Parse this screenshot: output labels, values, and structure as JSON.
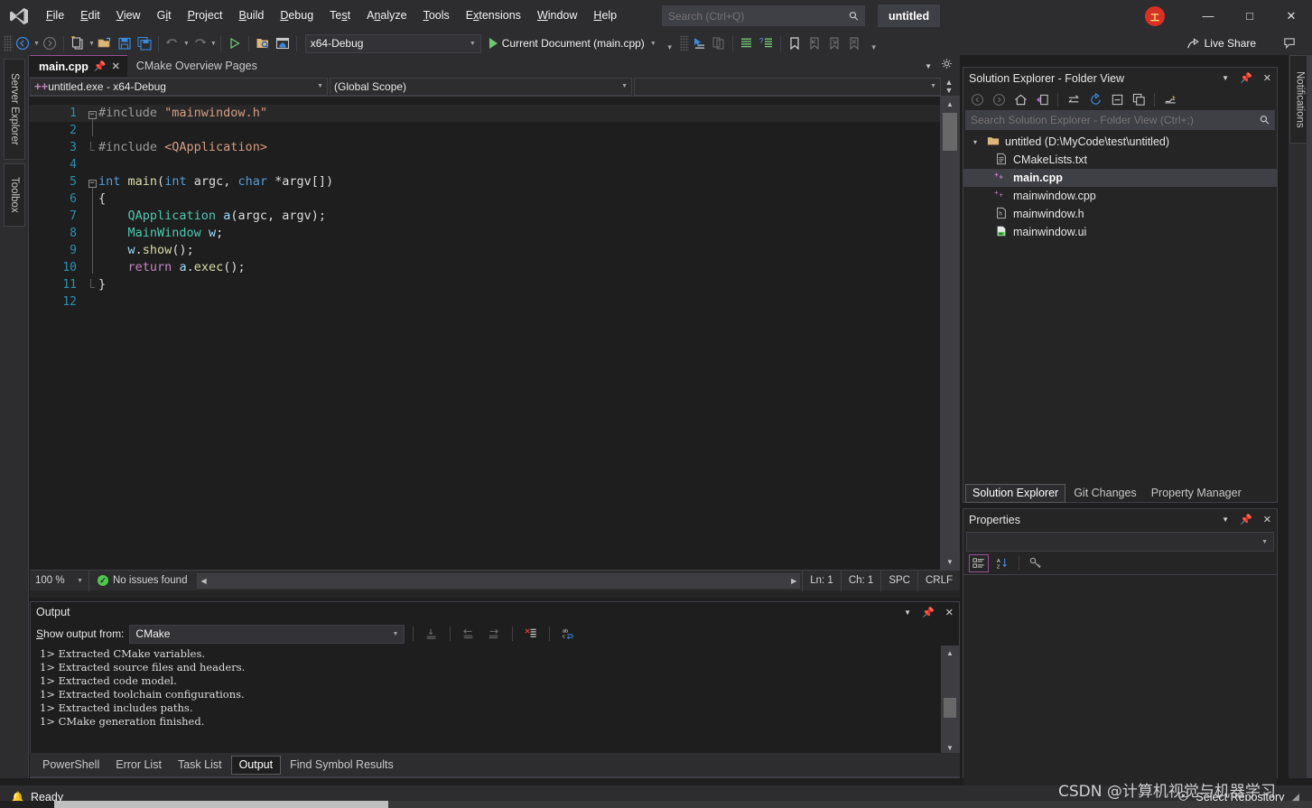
{
  "titlebar": {
    "logo": "visual-studio-logo",
    "menus": [
      "File",
      "Edit",
      "View",
      "Git",
      "Project",
      "Build",
      "Debug",
      "Test",
      "Analyze",
      "Tools",
      "Extensions",
      "Window",
      "Help"
    ],
    "search_placeholder": "Search (Ctrl+Q)",
    "window_title": "untitled",
    "user_badge": "工",
    "minimize": "minimize-icon",
    "maximize": "maximize-icon",
    "close": "close-icon"
  },
  "toolbar": {
    "back": "back-arrow-icon",
    "forward": "forward-arrow-icon",
    "new_item": "new-item-icon",
    "open_file": "open-file-icon",
    "save": "save-icon",
    "save_all": "save-all-icon",
    "undo": "undo-icon",
    "redo": "redo-icon",
    "run": "run-icon",
    "open_folder": "search-folder-icon",
    "home_window": "home-window-icon",
    "configuration": "x64-Debug",
    "startup_item": "Current Document (main.cpp)",
    "live_share": "Live Share",
    "feedback": "feedback-icon"
  },
  "left_rail": {
    "tabs": [
      "Server Explorer",
      "Toolbox"
    ]
  },
  "right_rail": {
    "tabs": [
      "Notifications"
    ]
  },
  "editor": {
    "tabs": [
      {
        "label": "main.cpp",
        "active": true,
        "pinned": true,
        "closable": true
      },
      {
        "label": "CMake Overview Pages",
        "active": false,
        "pinned": false,
        "closable": false
      }
    ],
    "navbar": {
      "project": "untitled.exe - x64-Debug",
      "scope": "(Global Scope)",
      "member": ""
    },
    "code": {
      "lines": [
        {
          "n": 1,
          "fold": "minus",
          "guide": false,
          "current": true,
          "tokens": [
            {
              "t": "#include ",
              "c": "pre"
            },
            {
              "t": "\"mainwindow.h\"",
              "c": "str"
            }
          ]
        },
        {
          "n": 2,
          "fold": "",
          "guide": true,
          "current": false,
          "tokens": []
        },
        {
          "n": 3,
          "fold": "end",
          "guide": true,
          "current": false,
          "tokens": [
            {
              "t": "#include ",
              "c": "pre"
            },
            {
              "t": "<QApplication>",
              "c": "str"
            }
          ]
        },
        {
          "n": 4,
          "fold": "",
          "guide": false,
          "current": false,
          "tokens": []
        },
        {
          "n": 5,
          "fold": "minus",
          "guide": false,
          "current": false,
          "tokens": [
            {
              "t": "int",
              "c": "kw"
            },
            {
              "t": " ",
              "c": "plain"
            },
            {
              "t": "main",
              "c": "fn"
            },
            {
              "t": "(",
              "c": "punc"
            },
            {
              "t": "int",
              "c": "kw"
            },
            {
              "t": " ",
              "c": "plain"
            },
            {
              "t": "argc",
              "c": "plain"
            },
            {
              "t": ", ",
              "c": "punc"
            },
            {
              "t": "char",
              "c": "kw"
            },
            {
              "t": " *",
              "c": "punc"
            },
            {
              "t": "argv",
              "c": "plain"
            },
            {
              "t": "[])",
              "c": "punc"
            }
          ]
        },
        {
          "n": 6,
          "fold": "bar",
          "guide": false,
          "current": false,
          "tokens": [
            {
              "t": "{",
              "c": "punc"
            }
          ]
        },
        {
          "n": 7,
          "fold": "bar",
          "guide": false,
          "current": false,
          "tokens": [
            {
              "t": "    ",
              "c": "plain"
            },
            {
              "t": "QApplication",
              "c": "type"
            },
            {
              "t": " ",
              "c": "plain"
            },
            {
              "t": "a",
              "c": "var"
            },
            {
              "t": "(argc, argv);",
              "c": "punc"
            }
          ]
        },
        {
          "n": 8,
          "fold": "bar",
          "guide": false,
          "current": false,
          "tokens": [
            {
              "t": "    ",
              "c": "plain"
            },
            {
              "t": "MainWindow",
              "c": "type"
            },
            {
              "t": " ",
              "c": "plain"
            },
            {
              "t": "w",
              "c": "var"
            },
            {
              "t": ";",
              "c": "punc"
            }
          ]
        },
        {
          "n": 9,
          "fold": "bar",
          "guide": false,
          "current": false,
          "tokens": [
            {
              "t": "    ",
              "c": "plain"
            },
            {
              "t": "w",
              "c": "var"
            },
            {
              "t": ".",
              "c": "punc"
            },
            {
              "t": "show",
              "c": "fn"
            },
            {
              "t": "();",
              "c": "punc"
            }
          ]
        },
        {
          "n": 10,
          "fold": "bar",
          "guide": false,
          "current": false,
          "tokens": [
            {
              "t": "    ",
              "c": "plain"
            },
            {
              "t": "return",
              "c": "kwp"
            },
            {
              "t": " ",
              "c": "plain"
            },
            {
              "t": "a",
              "c": "var"
            },
            {
              "t": ".",
              "c": "punc"
            },
            {
              "t": "exec",
              "c": "fn"
            },
            {
              "t": "();",
              "c": "punc"
            }
          ]
        },
        {
          "n": 11,
          "fold": "end",
          "guide": false,
          "current": false,
          "tokens": [
            {
              "t": "}",
              "c": "punc"
            }
          ]
        },
        {
          "n": 12,
          "fold": "",
          "guide": false,
          "current": false,
          "tokens": []
        }
      ]
    },
    "status": {
      "zoom": "100 %",
      "issues": "No issues found",
      "line": "Ln: 1",
      "char": "Ch: 1",
      "spaces": "SPC",
      "eol": "CRLF"
    }
  },
  "output": {
    "title": "Output",
    "filter_label": "Show output from:",
    "filter_value": "CMake",
    "toolbar_icons": [
      "clear-all-icon",
      "go-to-previous-icon",
      "go-to-next-icon",
      "clear-output-icon",
      "toggle-word-wrap-icon"
    ],
    "lines": [
      "1> Extracted CMake variables.",
      "1> Extracted source files and headers.",
      "1> Extracted code model.",
      "1> Extracted toolchain configurations.",
      "1> Extracted includes paths.",
      "1> CMake generation finished."
    ]
  },
  "bottom_tabs": [
    {
      "label": "PowerShell",
      "active": false
    },
    {
      "label": "Error List",
      "active": false
    },
    {
      "label": "Task List",
      "active": false
    },
    {
      "label": "Output",
      "active": true
    },
    {
      "label": "Find Symbol Results",
      "active": false
    }
  ],
  "solution_explorer": {
    "title": "Solution Explorer - Folder View",
    "toolbar_icons": [
      "back-icon",
      "forward-icon",
      "home-icon",
      "switch-views-icon",
      "sync-icon",
      "refresh-icon",
      "collapse-all-icon",
      "new-folder-icon",
      "show-all-files-icon"
    ],
    "search_placeholder": "Search Solution Explorer - Folder View (Ctrl+;)",
    "tree": [
      {
        "label": "untitled (D:\\MyCode\\test\\untitled)",
        "icon": "folder-icon",
        "depth": 0,
        "expanded": true,
        "selected": false,
        "bold": false
      },
      {
        "label": "CMakeLists.txt",
        "icon": "text-file-icon",
        "depth": 1,
        "expanded": null,
        "selected": false,
        "bold": false
      },
      {
        "label": "main.cpp",
        "icon": "cpp-file-icon",
        "depth": 1,
        "expanded": null,
        "selected": true,
        "bold": true
      },
      {
        "label": "mainwindow.cpp",
        "icon": "cpp-file-icon",
        "depth": 1,
        "expanded": null,
        "selected": false,
        "bold": false
      },
      {
        "label": "mainwindow.h",
        "icon": "header-file-icon",
        "depth": 1,
        "expanded": null,
        "selected": false,
        "bold": false
      },
      {
        "label": "mainwindow.ui",
        "icon": "ui-file-icon",
        "depth": 1,
        "expanded": null,
        "selected": false,
        "bold": false
      }
    ],
    "tabs": [
      {
        "label": "Solution Explorer",
        "active": true
      },
      {
        "label": "Git Changes",
        "active": false
      },
      {
        "label": "Property Manager",
        "active": false
      }
    ]
  },
  "properties": {
    "title": "Properties",
    "selected_object": "",
    "toolbar_icons": [
      "categorized-icon",
      "alphabetical-icon",
      "property-pages-icon"
    ]
  },
  "statusbar": {
    "ready": "Ready",
    "repository": "Select Repository"
  },
  "watermark": "CSDN @计算机视觉与机器学习",
  "colors": {
    "titlebar_bg": "#2d2d30",
    "editor_bg": "#1e1e1e",
    "panel_bg": "#252526",
    "accent_purple": "#9b4f96",
    "accent_blue": "#0078d4",
    "keyword_blue": "#569cd6",
    "type_teal": "#4ec9b0",
    "string_orange": "#d69d85",
    "function_yellow": "#dcdcaa",
    "preproc_gray": "#9b9b9b",
    "linenum_teal": "#2b91af",
    "ok_green": "#4ec94e"
  }
}
